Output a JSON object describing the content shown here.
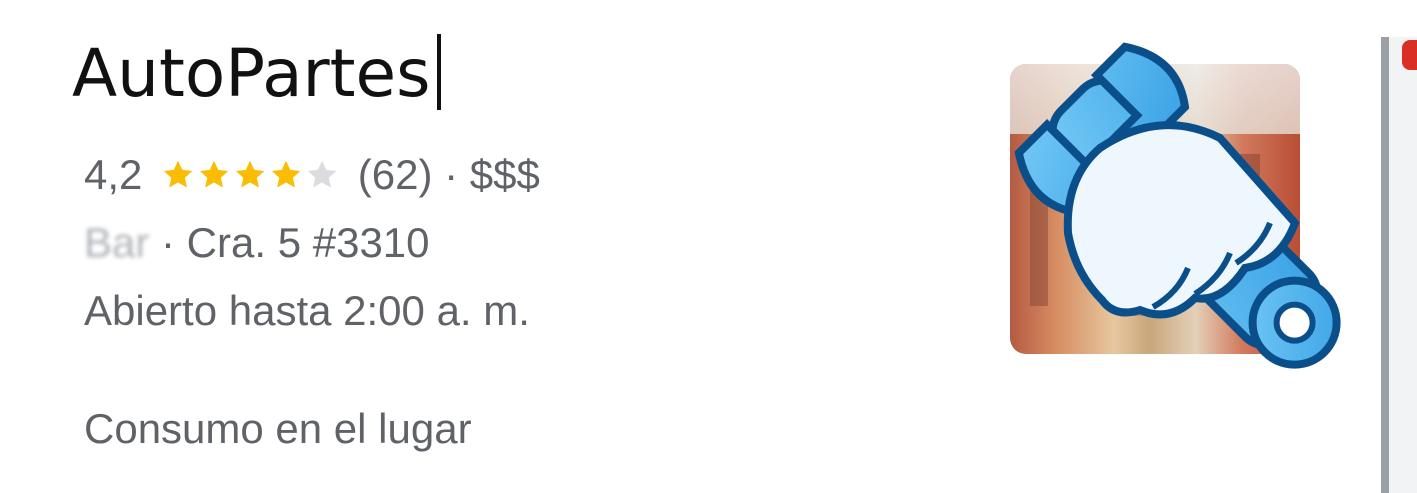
{
  "place": {
    "name": "AutoPartes",
    "rating": "4,2",
    "stars_filled": 4,
    "stars_total": 5,
    "reviews": "(62)",
    "price_level": "· $$$",
    "category_blurred": "Bar",
    "address": "· Cra. 5 #3310",
    "hours": "Abierto hasta 2:00 a. m.",
    "service_option": "Consumo en el lugar"
  },
  "icons": {
    "star": "star-icon",
    "wrench": "wrench-icon"
  },
  "colors": {
    "star_filled": "#fbbc04",
    "star_empty": "#dadce0",
    "text_secondary": "#5f6368",
    "wrench_blue": "#5ab8ef",
    "wrench_outline": "#0b4f8a"
  }
}
